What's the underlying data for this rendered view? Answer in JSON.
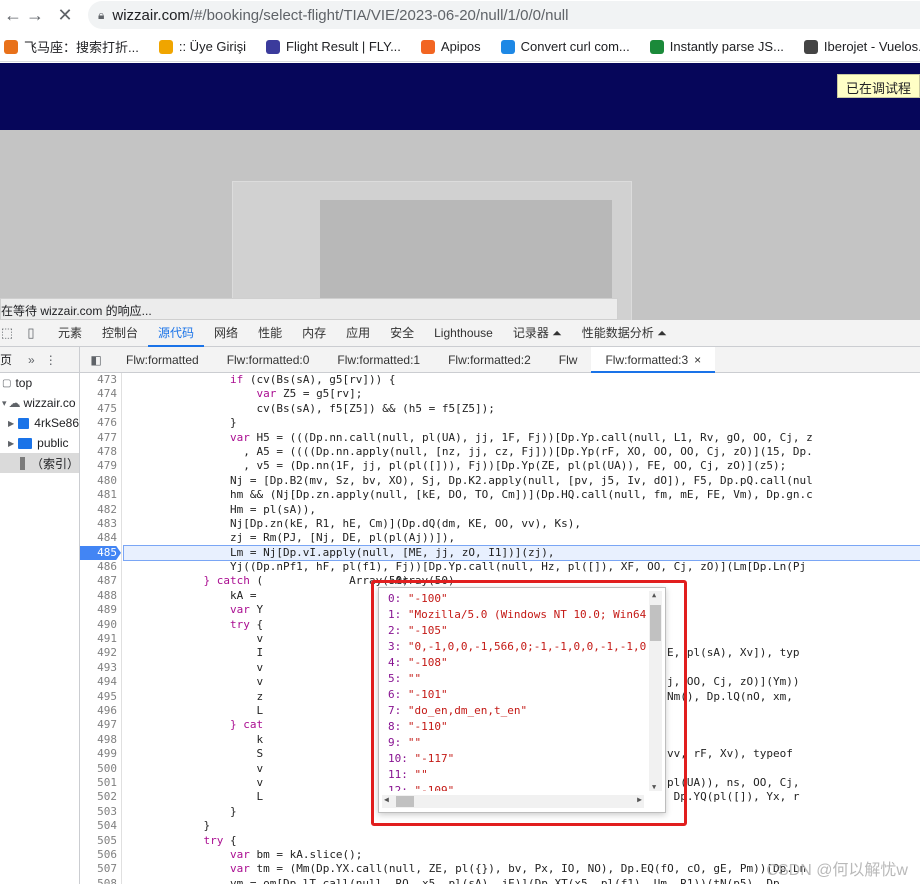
{
  "browser": {
    "url_host": "wizzair.com",
    "url_path": "/#/booking/select-flight/TIA/VIE/2023-06-20/null/1/0/0/null",
    "bookmarks": [
      {
        "label": "飞马座：搜索打折...",
        "color": "#e8711a"
      },
      {
        "label": ":: Üye Girişi",
        "color": "#f0a500"
      },
      {
        "label": "Flight Result | FLY...",
        "color": "#3b3b9c"
      },
      {
        "label": "Apipos",
        "color": "#f26522"
      },
      {
        "label": "Convert curl com...",
        "color": "#1e88e5"
      },
      {
        "label": "Instantly parse JS...",
        "color": "#1b8a3a"
      },
      {
        "label": "Iberojet - Vuelos...",
        "color": "#444444"
      }
    ]
  },
  "page": {
    "debug_badge": "已在调试程",
    "status": "在等待 wizzair.com 的响应..."
  },
  "devtools": {
    "tabs": [
      "元素",
      "控制台",
      "源代码",
      "网络",
      "性能",
      "内存",
      "应用",
      "安全",
      "Lighthouse",
      "记录器 ⏶",
      "性能数据分析 ⏶"
    ],
    "active_tab": "源代码",
    "left_head": "页",
    "tree": [
      {
        "label": "top",
        "kind": "frame"
      },
      {
        "label": "wizzair.co",
        "kind": "cloud"
      },
      {
        "label": "4rkSe86",
        "kind": "folder"
      },
      {
        "label": "public",
        "kind": "folder"
      },
      {
        "label": "（索引）",
        "kind": "file"
      }
    ],
    "file_tabs": [
      "Flw:formatted",
      "Flw:formatted:0",
      "Flw:formatted:1",
      "Flw:formatted:2",
      "Flw",
      "Flw:formatted:3"
    ],
    "active_file": "Flw:formatted:3",
    "close_glyph": "×"
  },
  "code": {
    "breakpoint_line": "485",
    "lines": [
      {
        "n": "473",
        "t": "                if (cv(Bs(sA), g5[rv])) {"
      },
      {
        "n": "474",
        "t": "                    var Z5 = g5[rv];"
      },
      {
        "n": "475",
        "t": "                    cv(Bs(sA), f5[Z5]) && (h5 = f5[Z5]);"
      },
      {
        "n": "476",
        "t": "                }"
      },
      {
        "n": "477",
        "t": "                var H5 = (((Dp.nn.call(null, pl(UA), jj, 1F, Fj))[Dp.Yp.call(null, L1, Rv, gO, OO, Cj, z"
      },
      {
        "n": "478",
        "t": "                  , A5 = ((((Dp.nn.apply(null, [nz, jj, cz, Fj]))[Dp.Yp(rF, XO, OO, OO, Cj, zO)](15, Dp."
      },
      {
        "n": "479",
        "t": "                  , v5 = (Dp.nn(1F, jj, pl(pl([])), Fj))[Dp.Yp(ZE, pl(pl(UA)), FE, OO, Cj, zO)](z5);"
      },
      {
        "n": "480",
        "t": "                Nj = [Dp.B2(mv, Sz, bv, XO), Sj, Dp.K2.apply(null, [pv, j5, Iv, dO]), F5, Dp.pQ.call(nul"
      },
      {
        "n": "481",
        "t": "                hm && (Nj[Dp.zn.apply(null, [kE, DO, TO, Cm])](Dp.HQ.call(null, fm, mE, FE, Vm), Dp.gn.c"
      },
      {
        "n": "482",
        "t": "                Hm = pl(sA)),"
      },
      {
        "n": "483",
        "t": "                Nj[Dp.zn(kE, R1, hE, Cm)](Dp.dQ(dm, KE, OO, vv), Ks),"
      },
      {
        "n": "484",
        "t": "                zj = Rm(PJ, [Nj, DE, pl(pl(Aj))]),"
      },
      {
        "n": "485",
        "t": "                Lm = Nj[Dp.vI.apply(null, [ME, jj, zO, I1])](zj),"
      },
      {
        "n": "486",
        "t": "                Yj((Dp.nPf1, hF, pl(f1), Fj))[Dp.Yp.call(null, Hz, pl([]), XF, OO, Cj, zO)](Lm[Dp.Ln(Pj"
      },
      {
        "n": "487",
        "t": "            } catch (             Array(50)"
      },
      {
        "n": "488",
        "t": "                kA ="
      },
      {
        "n": "489",
        "t": "                var Y"
      },
      {
        "n": "490",
        "t": "                try {"
      },
      {
        "n": "491",
        "t": "                    v"
      },
      {
        "n": "492",
        "t": "                    I                                           apply(null, [NO, JE, pl(sA), Xv]), typ"
      },
      {
        "n": "493",
        "t": "                    v"
      },
      {
        "n": "494",
        "t": "                    v                                           ll(null, nO, vv, dj, OO, Cj, zO)](Ym))"
      },
      {
        "n": "495",
        "t": "                    z                                           pl(pl({})), XO]), Nm(), Dp.lQ(nO, xm,"
      },
      {
        "n": "496",
        "t": "                    L"
      },
      {
        "n": "497",
        "t": "                } cat"
      },
      {
        "n": "498",
        "t": "                    k"
      },
      {
        "n": "499",
        "t": "                    S                                           IT call(null, NO, vv, rF, Xv), typeof"
      },
      {
        "n": "500",
        "t": "                    v"
      },
      {
        "n": "501",
        "t": "                    v                                           ply(null, [gE, pl(pl(UA)), ns, OO, Cj,"
      },
      {
        "n": "502",
        "t": "                    L                                           , OO, Cj, zO)](Lm, Dp.YQ(pl([]), Yx, r"
      },
      {
        "n": "503",
        "t": "                }"
      },
      {
        "n": "504",
        "t": "            }"
      },
      {
        "n": "505",
        "t": "            try {"
      },
      {
        "n": "506",
        "t": "                var bm = kA.slice();"
      },
      {
        "n": "507",
        "t": "                var tm = (Mm(Dp.YX.call(null, ZE, pl({}), bv, Px, IO, NO), Dp.EQ(fO, cO, gE, Pm))[Dp.Ln"
      },
      {
        "n": "508",
        "t": "                vm = om[Dp.lT.call(null, RO, x5, pl(sA), jE)](Dp.XT(x5, pl(f1), Um, R1))(tN(p5), Dp"
      }
    ]
  },
  "popup": {
    "title": "Array(50)",
    "items": [
      {
        "k": "0:",
        "v": "\"-100\""
      },
      {
        "k": "1:",
        "v": "\"Mozilla/5.0 (Windows NT 10.0; Win64"
      },
      {
        "k": "2:",
        "v": "\"-105\""
      },
      {
        "k": "3:",
        "v": "\"0,-1,0,0,-1,566,0;-1,-1,0,0,-1,-1,0"
      },
      {
        "k": "4:",
        "v": "\"-108\""
      },
      {
        "k": "5:",
        "v": "\"\""
      },
      {
        "k": "6:",
        "v": "\"-101\""
      },
      {
        "k": "7:",
        "v": "\"do_en,dm_en,t_en\""
      },
      {
        "k": "8:",
        "v": "\"-110\""
      },
      {
        "k": "9:",
        "v": "\"\""
      },
      {
        "k": "10:",
        "v": "\"-117\""
      },
      {
        "k": "11:",
        "v": "\"\""
      },
      {
        "k": "12:",
        "v": "\"-109\""
      }
    ]
  },
  "watermark": "CSDN @何以解忧w"
}
